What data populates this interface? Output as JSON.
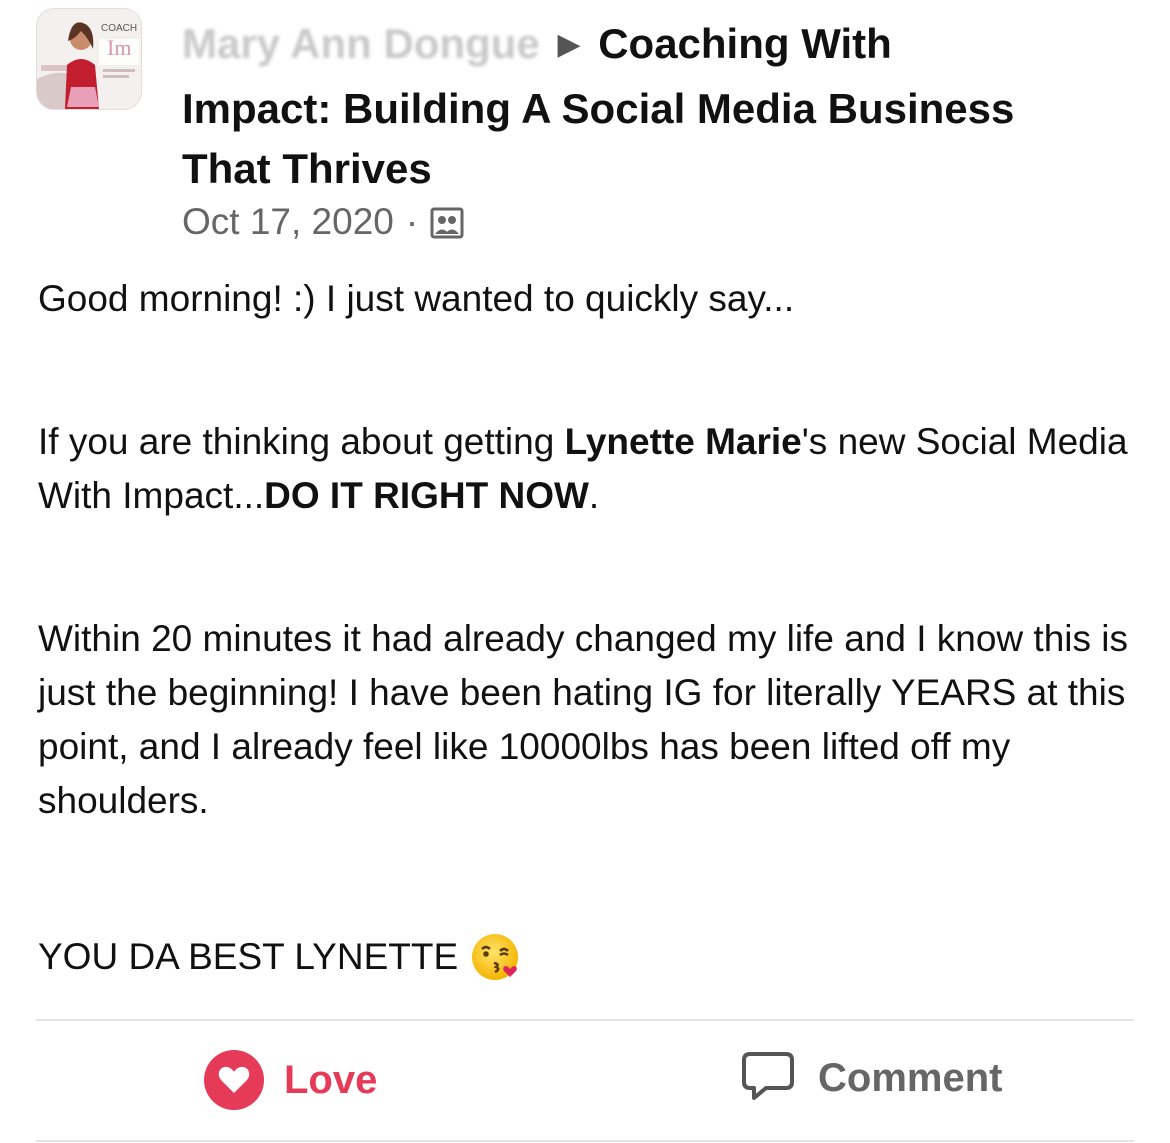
{
  "post": {
    "avatar_text": "COACH",
    "author_name_obscured": "Mary Ann Dongue",
    "arrow": "▶",
    "group_name_line1": "Coaching With",
    "group_name_line2": "Impact: Building A Social Media Business",
    "group_name_line3": "That Thrives",
    "date": "Oct 17, 2020",
    "separator": "·",
    "audience_icon": "group-icon"
  },
  "content": {
    "p1": "Good morning! :) I just wanted to quickly say...",
    "p2_pre": "If you are thinking about getting ",
    "p2_bold1": "Lynette Marie",
    "p2_mid": "'s new Social Media With Impact...",
    "p2_bold2": "DO IT RIGHT NOW",
    "p2_post": ".",
    "p3": "Within 20 minutes it had already changed my life and I know this is just the beginning! I have been hating IG for literally YEARS at this point, and I already feel like 10000lbs has been lifted off my shoulders.",
    "p4": "YOU DA BEST LYNETTE",
    "emoji": "face-blowing-a-kiss"
  },
  "actions": {
    "love_label": "Love",
    "comment_label": "Comment"
  },
  "colors": {
    "love": "#e53b58",
    "muted": "#666666"
  }
}
